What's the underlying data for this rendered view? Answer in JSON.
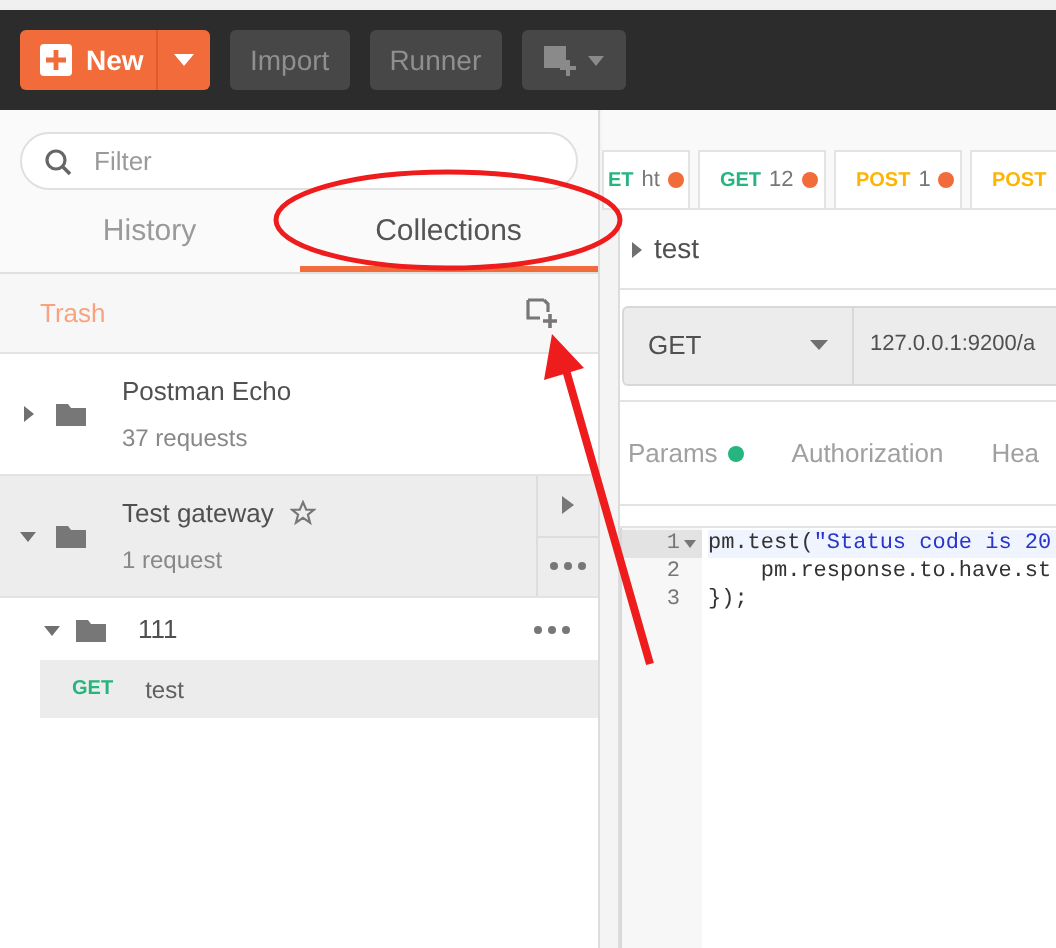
{
  "toolbar": {
    "new_button": "New",
    "buttons": [
      "Import",
      "Runner"
    ]
  },
  "sidebar": {
    "filter_placeholder": "Filter",
    "tabs": [
      {
        "label": "History",
        "selected": false
      },
      {
        "label": "Collections",
        "selected": true
      }
    ],
    "trash": "Trash",
    "collections": [
      {
        "name": "Postman Echo",
        "count": "37 requests",
        "expanded": false,
        "selected": false
      },
      {
        "name": "Test gateway",
        "count": "1 request",
        "expanded": true,
        "selected": true,
        "children": [
          {
            "name": "111",
            "expanded": true,
            "children": [
              {
                "method": "GET",
                "name": "test",
                "selected": true
              }
            ]
          }
        ]
      }
    ]
  },
  "request_tabs": [
    {
      "method": "ET",
      "color": "#26b47f",
      "label": "ht",
      "unsaved": true
    },
    {
      "method": "GET",
      "color": "#26b47f",
      "label": "12",
      "unsaved": true
    },
    {
      "method": "POST",
      "color": "#ffb400",
      "label": "1",
      "unsaved": true
    },
    {
      "method": "POST",
      "color": "#ffb400",
      "unsaved": false
    }
  ],
  "request": {
    "name": "test",
    "method": "GET",
    "url": "127.0.0.1:9200/a",
    "tabs": [
      {
        "label": "Params",
        "dot": true
      },
      {
        "label": "Authorization",
        "dot": false
      },
      {
        "label": "Hea",
        "dot": false
      }
    ],
    "code": [
      {
        "number": "1",
        "foldable": true,
        "tokens": [
          {
            "text": "pm.test(",
            "kind": "plain"
          },
          {
            "text": "\"Status code is 20",
            "kind": "string"
          }
        ]
      },
      {
        "number": "2",
        "foldable": false,
        "tokens": [
          {
            "text": "    pm.response.to.have.st",
            "kind": "plain"
          }
        ]
      },
      {
        "number": "3",
        "foldable": false,
        "tokens": [
          {
            "text": "});",
            "kind": "plain"
          }
        ]
      }
    ]
  }
}
